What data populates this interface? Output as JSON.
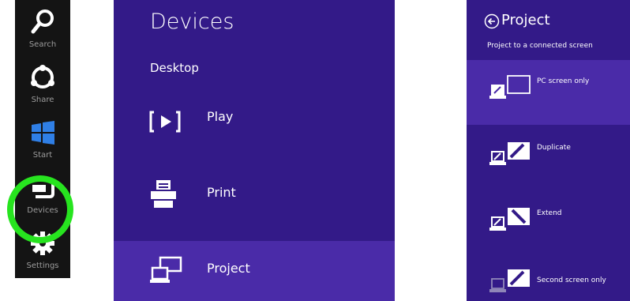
{
  "charms": [
    {
      "label": "Search",
      "icon": "search-icon"
    },
    {
      "label": "Share",
      "icon": "share-icon"
    },
    {
      "label": "Start",
      "icon": "windows-logo-icon"
    },
    {
      "label": "Devices",
      "icon": "devices-icon"
    },
    {
      "label": "Settings",
      "icon": "gear-icon"
    }
  ],
  "devices_pane": {
    "title": "Devices",
    "section": "Desktop",
    "items": [
      {
        "label": "Play",
        "icon": "play-icon"
      },
      {
        "label": "Print",
        "icon": "printer-icon"
      },
      {
        "label": "Project",
        "icon": "project-icon",
        "selected": true
      }
    ]
  },
  "project_pane": {
    "title": "Project",
    "subtitle": "Project to a connected screen",
    "options": [
      {
        "label": "PC screen only",
        "icon": "pc-screen-only-icon",
        "selected": true
      },
      {
        "label": "Duplicate",
        "icon": "duplicate-icon"
      },
      {
        "label": "Extend",
        "icon": "extend-icon"
      },
      {
        "label": "Second screen only",
        "icon": "second-screen-only-icon"
      }
    ]
  },
  "colors": {
    "pane_bg": "#331a88",
    "selected_bg": "#4a2ba8",
    "charms_bg": "#141414",
    "highlight_ring": "#27e41f"
  }
}
